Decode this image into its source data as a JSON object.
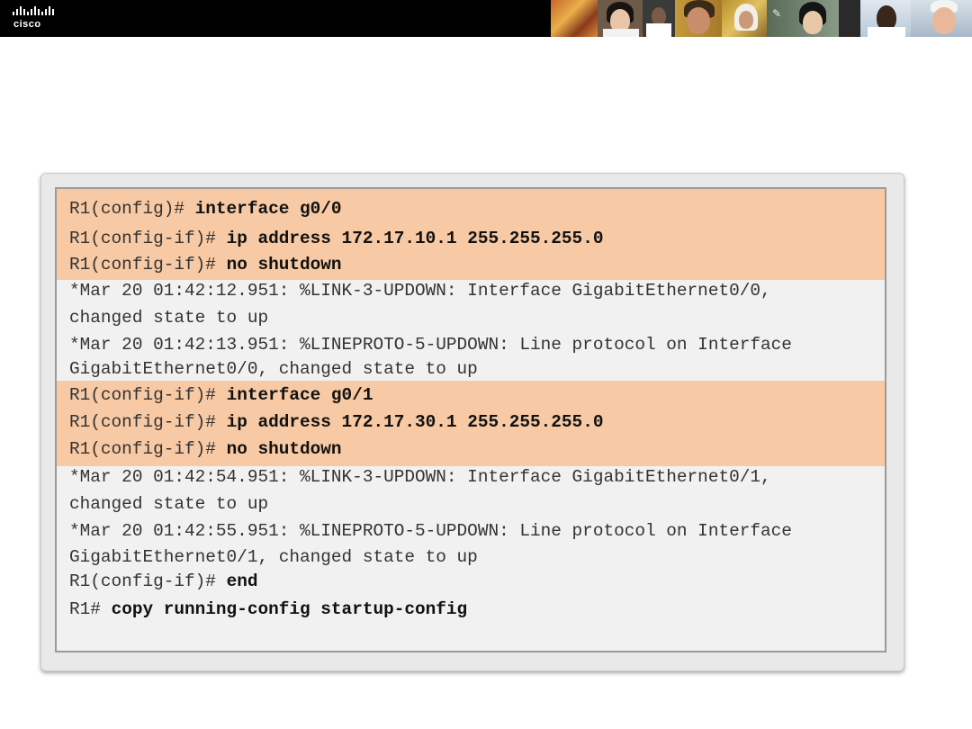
{
  "header": {
    "logo_text": "cisco",
    "logo_icon": "cisco-bridge-logo-icon",
    "banner_photos": "people-photo-strip"
  },
  "colors": {
    "header_bg": "#000000",
    "command_highlight": "#f7c9a4",
    "output_bg": "#f1f1f1"
  },
  "terminal": {
    "blocks": [
      {
        "type": "command",
        "lines": [
          {
            "prompt": "R1(config)#",
            "command": "interface g0/0"
          },
          {
            "prompt": "R1(config-if)#",
            "command": "ip address 172.17.10.1 255.255.255.0"
          },
          {
            "prompt": "R1(config-if)#",
            "command": "no shutdown"
          }
        ]
      },
      {
        "type": "output",
        "lines": [
          "*Mar 20 01:42:12.951: %LINK-3-UPDOWN: Interface GigabitEthernet0/0,",
          "changed state to up",
          "*Mar 20 01:42:13.951: %LINEPROTO-5-UPDOWN: Line protocol on Interface",
          "GigabitEthernet0/0, changed state to up"
        ]
      },
      {
        "type": "command",
        "lines": [
          {
            "prompt": "R1(config-if)#",
            "command": "interface g0/1"
          },
          {
            "prompt": "R1(config-if)#",
            "command": "ip address 172.17.30.1 255.255.255.0"
          },
          {
            "prompt": "R1(config-if)#",
            "command": "no shutdown"
          }
        ]
      },
      {
        "type": "output",
        "lines": [
          "*Mar 20 01:42:54.951: %LINK-3-UPDOWN: Interface GigabitEthernet0/1,",
          "changed state to up",
          "*Mar 20 01:42:55.951: %LINEPROTO-5-UPDOWN: Line protocol on Interface",
          "GigabitEthernet0/1, changed state to up"
        ]
      },
      {
        "type": "output-commands",
        "lines": [
          {
            "prompt": "R1(config-if)#",
            "command": "end"
          },
          {
            "prompt": "R1#",
            "command": "copy running-config startup-config"
          }
        ]
      }
    ]
  }
}
